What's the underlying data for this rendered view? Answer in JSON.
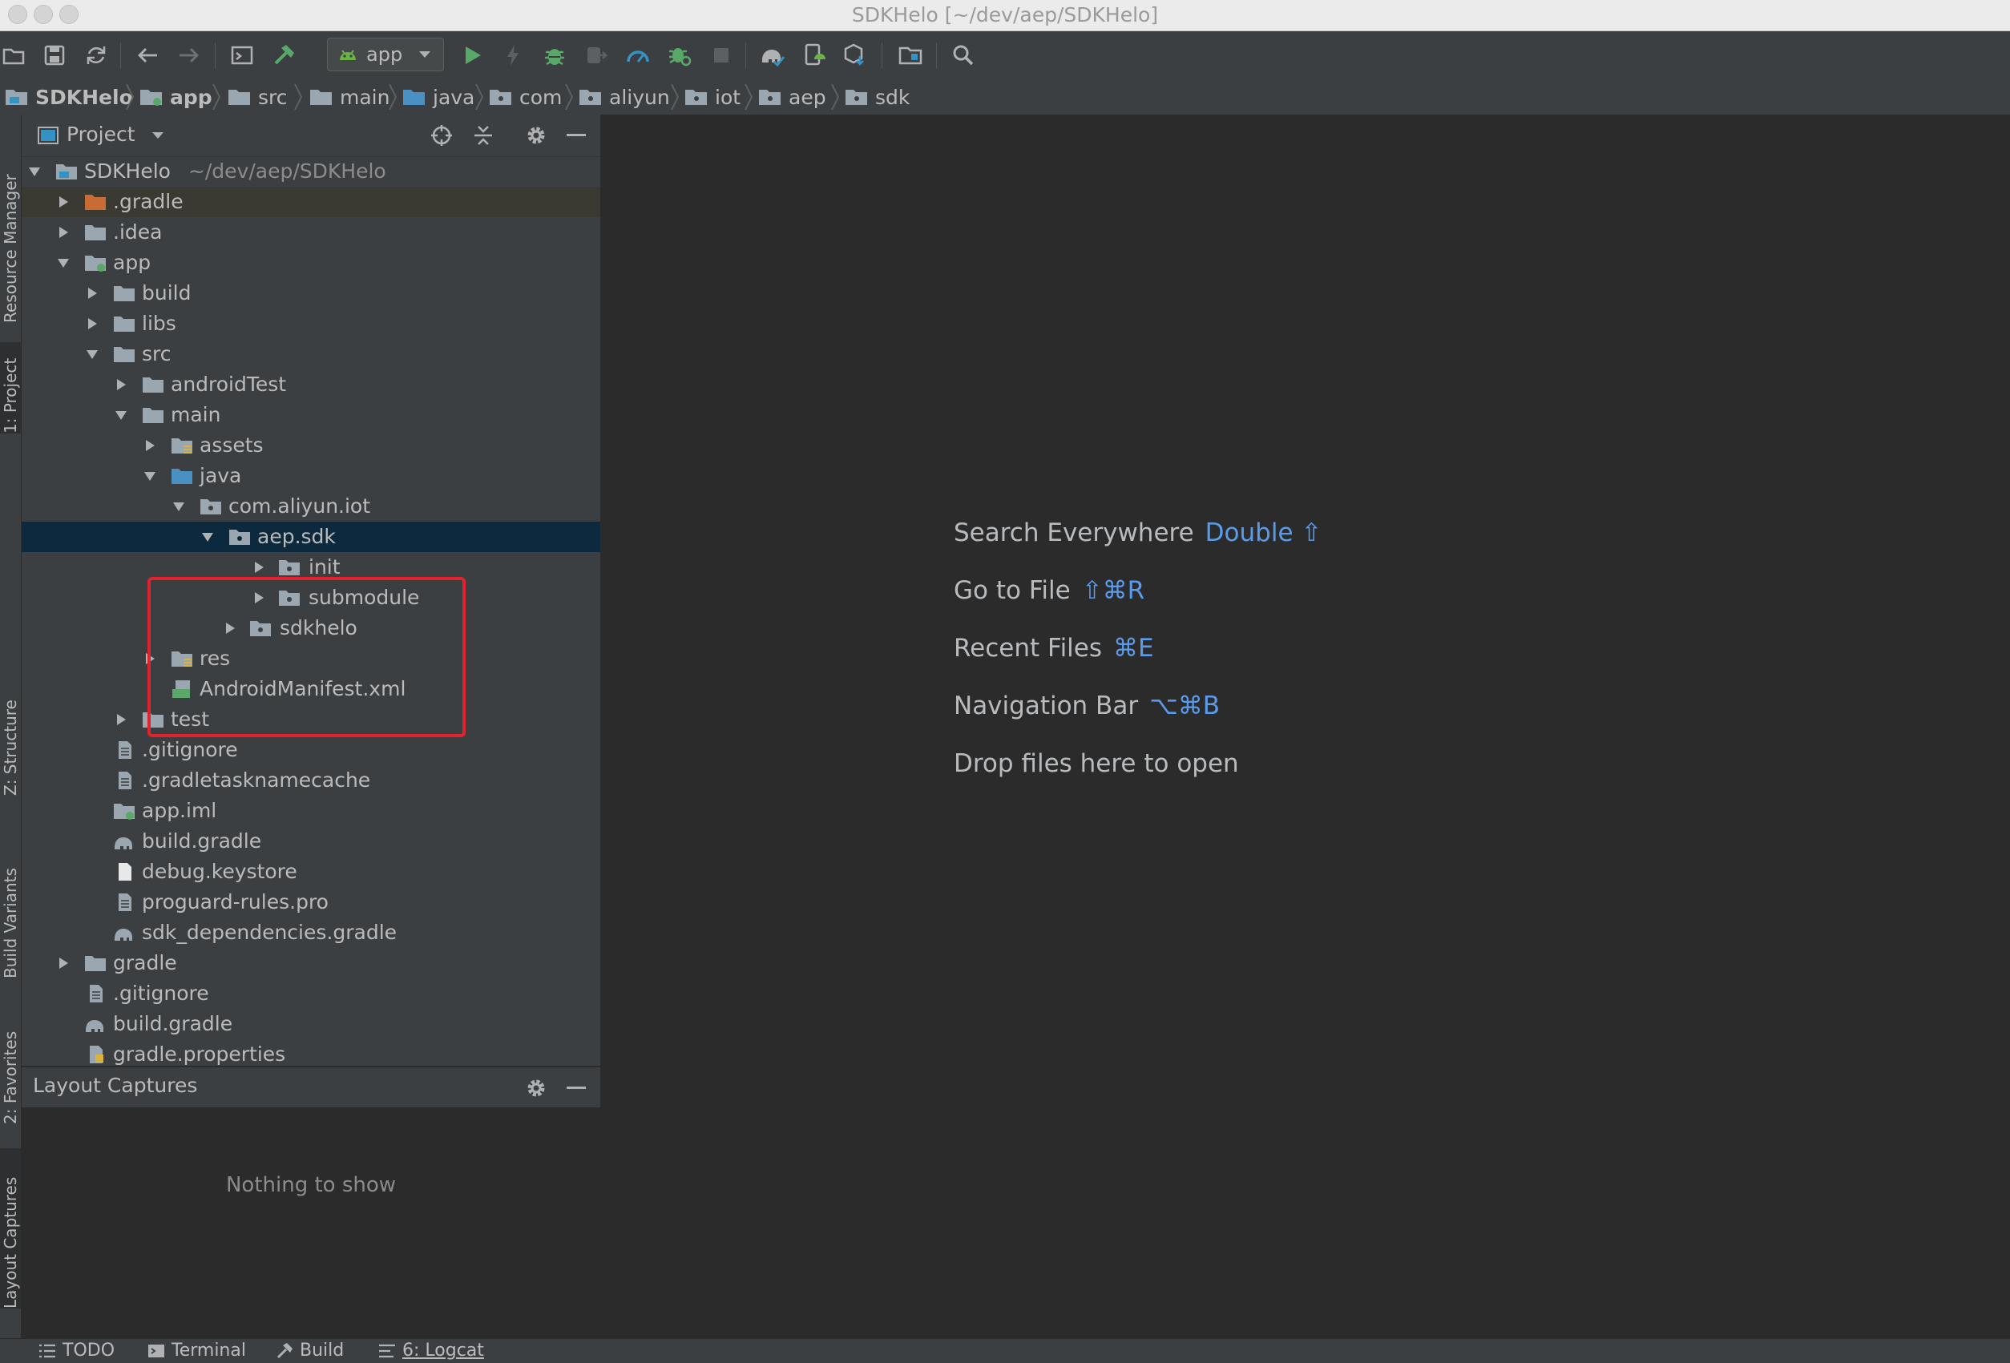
{
  "window": {
    "title": "SDKHelo [~/dev/aep/SDKHelo]"
  },
  "toolbar": {
    "run_config": "app"
  },
  "breadcrumb": [
    "SDKHelo",
    "app",
    "src",
    "main",
    "java",
    "com",
    "aliyun",
    "iot",
    "aep",
    "sdk"
  ],
  "project_panel": {
    "title": "Project"
  },
  "tree": {
    "root": {
      "name": "SDKHelo",
      "path": "~/dev/aep/SDKHelo"
    },
    "items": [
      ".gradle",
      ".idea",
      "app",
      "build",
      "libs",
      "src",
      "androidTest",
      "main",
      "assets",
      "java",
      "com.aliyun.iot",
      "aep.sdk",
      "init",
      "submodule",
      "sdkhelo",
      "res",
      "AndroidManifest.xml",
      "test",
      ".gitignore",
      ".gradletasknamecache",
      "app.iml",
      "build.gradle",
      "debug.keystore",
      "proguard-rules.pro",
      "sdk_dependencies.gradle",
      "gradle",
      ".gitignore",
      "build.gradle",
      "gradle.properties"
    ]
  },
  "tool_windows": {
    "left": [
      "Resource Manager",
      "1: Project",
      "Z: Structure",
      "Build Variants",
      "2: Favorites",
      "Layout Captures"
    ]
  },
  "captures_panel": {
    "title": "Layout Captures",
    "empty_text": "Nothing to show"
  },
  "editor": {
    "hints": [
      {
        "label": "Search Everywhere",
        "shortcut": "Double ⇧"
      },
      {
        "label": "Go to File",
        "shortcut": "⇧⌘R"
      },
      {
        "label": "Recent Files",
        "shortcut": "⌘E"
      },
      {
        "label": "Navigation Bar",
        "shortcut": "⌥⌘B"
      },
      {
        "label": "Drop files here to open",
        "shortcut": ""
      }
    ]
  },
  "status_bar": {
    "items": [
      "TODO",
      "Terminal",
      "Build",
      "6: Logcat"
    ]
  },
  "colors": {
    "accent": "#5a9ceb",
    "selection": "#0d293e",
    "highlight_box": "#e2232d"
  }
}
